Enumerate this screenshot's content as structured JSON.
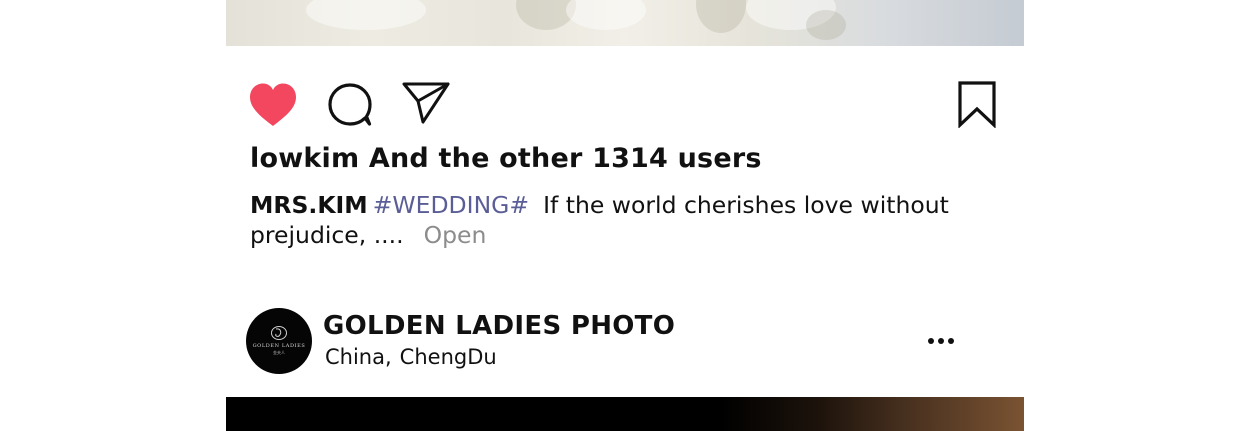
{
  "post": {
    "likes_text": "lowkim And the other 1314 users",
    "caption": {
      "author": "MRS.KIM",
      "hashtag": "#WEDDING#",
      "text": "If the world cherishes love without prejudice, ....",
      "open_label": "Open"
    },
    "icons": {
      "like": "heart-icon",
      "comment": "comment-icon",
      "share": "send-icon",
      "save": "bookmark-icon"
    },
    "liked": true,
    "like_color": "#f2475f"
  },
  "next_post": {
    "account_name": "GOLDEN LADIES PHOTO",
    "location_country": "China,",
    "location_city": "ChengDu",
    "avatar_logo": "GOLDEN LADIES",
    "avatar_logo_sub": "金夫人",
    "more_icon": "more-icon"
  },
  "colors": {
    "hashtag": "#5b5e96",
    "open_link": "#8c8c8c",
    "text": "#111111"
  }
}
